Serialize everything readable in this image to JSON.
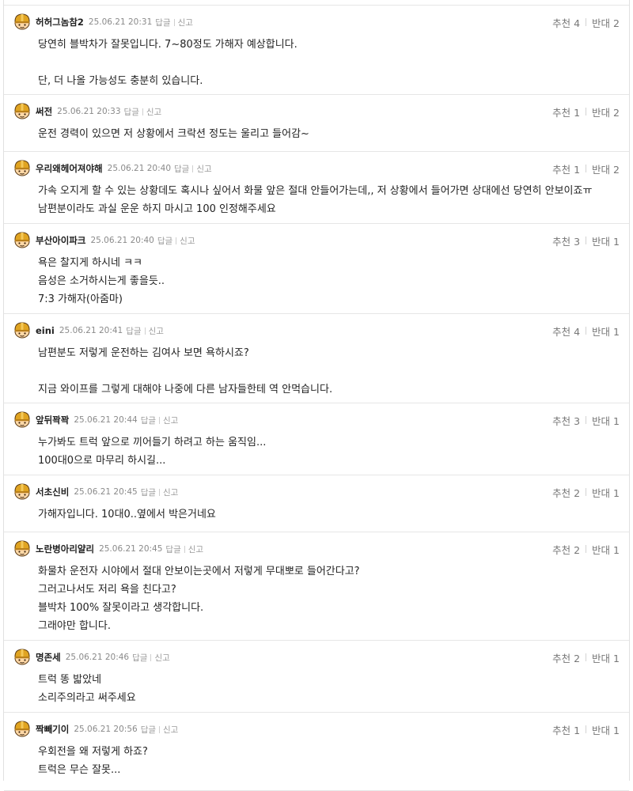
{
  "labels": {
    "reply": "답글",
    "report": "신고",
    "up": "추천",
    "down": "반대"
  },
  "colors": {
    "helmet": "#e0a422",
    "skin": "#ffd9a8",
    "text": "#222222",
    "muted": "#8a8a8a"
  },
  "comments": [
    {
      "nick": "허허그놈참2",
      "date": "25.06.21 20:31",
      "up": "4",
      "down": "2",
      "lines": [
        "당연히 블박차가 잘못입니다. 7~80정도 가해자 예상합니다.",
        "",
        "단, 더 나올 가능성도 충분히 있습니다."
      ]
    },
    {
      "nick": "써전",
      "date": "25.06.21 20:33",
      "up": "1",
      "down": "2",
      "lines": [
        "운전 경력이 있으면 저 상황에서 크락션 정도는 울리고 들어감~"
      ]
    },
    {
      "nick": "우리왜헤어져야해",
      "date": "25.06.21 20:40",
      "up": "1",
      "down": "2",
      "lines": [
        "가속 오지게 할 수 있는 상황데도 혹시나 싶어서 화물 앞은 절대 안들어가는데,, 저 상황에서 들어가면 상대에선 당연히 안보이죠ㅠ",
        "남편분이라도 과실 운운 하지 마시고 100 인정해주세요"
      ]
    },
    {
      "nick": "부산아이파크",
      "date": "25.06.21 20:40",
      "up": "3",
      "down": "1",
      "lines": [
        "욕은 찰지게 하시네 ㅋㅋ",
        "음성은 소거하시는게 좋을듯..",
        "7:3 가해자(아줌마)"
      ]
    },
    {
      "nick": "eini",
      "date": "25.06.21 20:41",
      "up": "4",
      "down": "1",
      "lines": [
        "남편분도 저렇게 운전하는 김여사 보면 욕하시죠?",
        "",
        "지금 와이프를 그렇게 대해야 나중에 다른 남자들한테 역 안먹습니다."
      ]
    },
    {
      "nick": "앞뒤꽉꽉",
      "date": "25.06.21 20:44",
      "up": "3",
      "down": "1",
      "lines": [
        "누가봐도 트럭 앞으로 끼어들기 하려고 하는 움직임...",
        "100대0으로 마무리 하시길..."
      ]
    },
    {
      "nick": "서초신비",
      "date": "25.06.21 20:45",
      "up": "2",
      "down": "1",
      "lines": [
        "가해자입니다. 10대0..옆에서 박은거네요"
      ]
    },
    {
      "nick": "노란병아리얄리",
      "date": "25.06.21 20:45",
      "up": "2",
      "down": "1",
      "lines": [
        "화물차 운전자 시야에서 절대 안보이는곳에서 저렇게 무대뽀로 들어간다고?",
        "그러고나서도 저리 욕을 친다고?",
        "블박차 100% 잘못이라고 생각합니다.",
        "그래야만 합니다."
      ]
    },
    {
      "nick": "명존세",
      "date": "25.06.21 20:46",
      "up": "2",
      "down": "1",
      "lines": [
        "트럭 똥 밟았네",
        "소리주의라고 써주세요"
      ]
    },
    {
      "nick": "짝빼기이",
      "date": "25.06.21 20:56",
      "up": "1",
      "down": "1",
      "lines": [
        "우회전을 왜 저렇게 하죠?",
        "트럭은 무슨 잘못..."
      ]
    }
  ]
}
